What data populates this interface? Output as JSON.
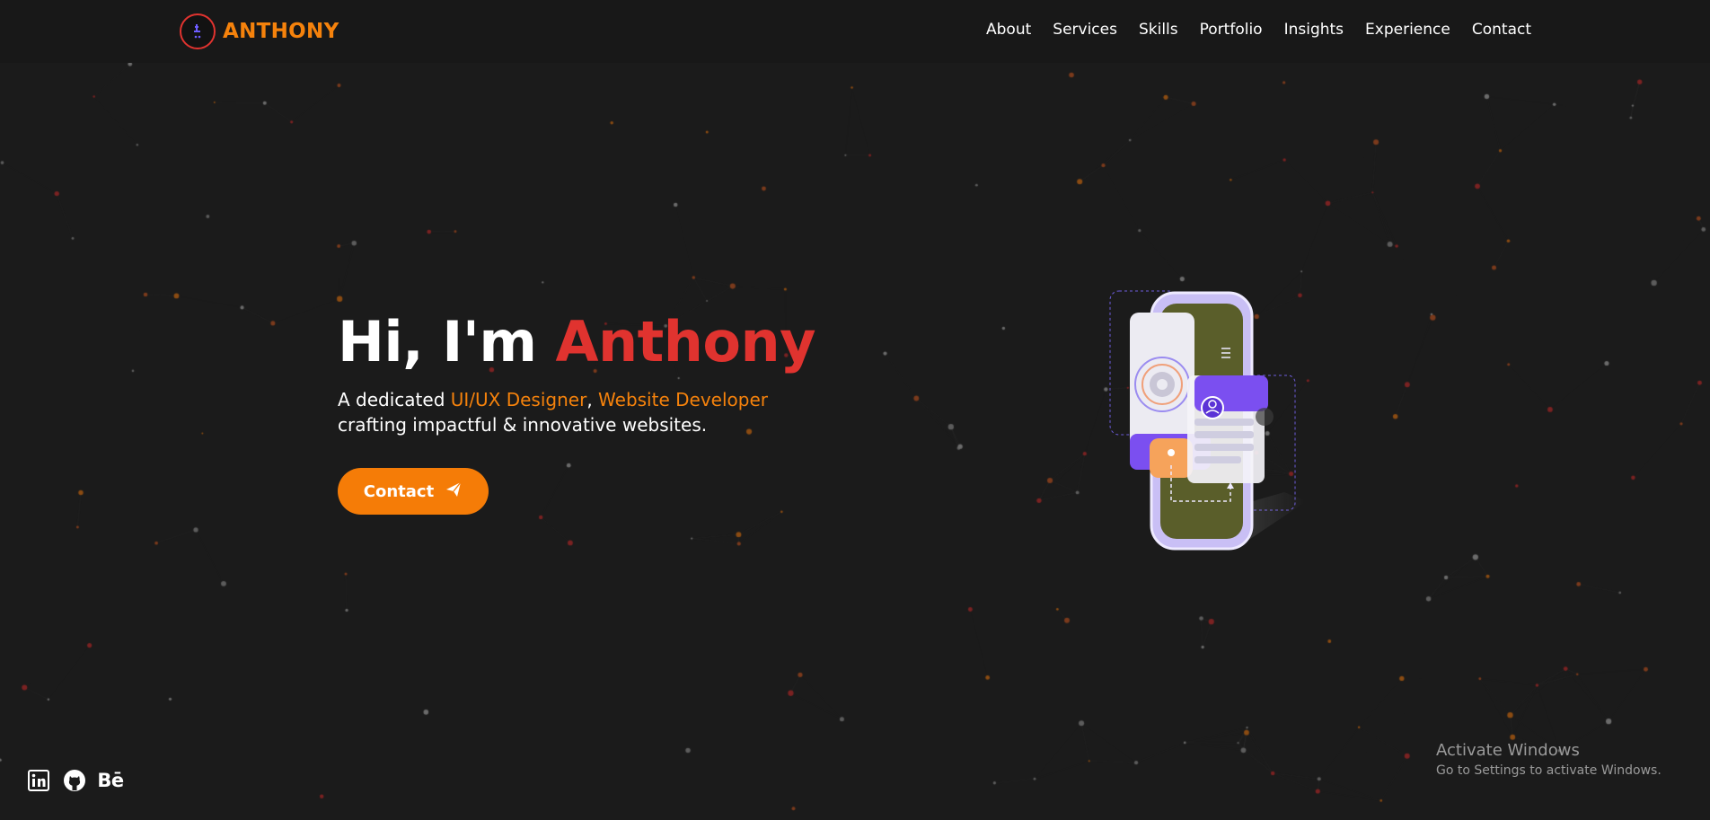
{
  "brand": {
    "name": "ANTHONY"
  },
  "nav": {
    "items": [
      "About",
      "Services",
      "Skills",
      "Portfolio",
      "Insights",
      "Experience",
      "Contact"
    ]
  },
  "hero": {
    "greeting": "Hi, I'm ",
    "name": "Anthony",
    "sub_prefix": "A dedicated ",
    "role1": "UI/UX Designer",
    "sep": ", ",
    "role2": "Website Developer",
    "sub_line2": "crafting impactful & innovative websites.",
    "cta_label": "Contact"
  },
  "socials": {
    "behance_label": "Bē"
  },
  "icons": [
    "logo-icon",
    "send-icon",
    "linkedin-icon",
    "github-icon",
    "behance-icon",
    "phone-illustration"
  ],
  "os_watermark": {
    "title": "Activate Windows",
    "subtitle": "Go to Settings to activate Windows."
  },
  "colors": {
    "background": "#1b1b1b",
    "navbar": "#181818",
    "accent_orange": "#f57c07",
    "accent_red": "#e0332f",
    "text": "#ffffff",
    "illustration_purple": "#7b4ff0"
  }
}
